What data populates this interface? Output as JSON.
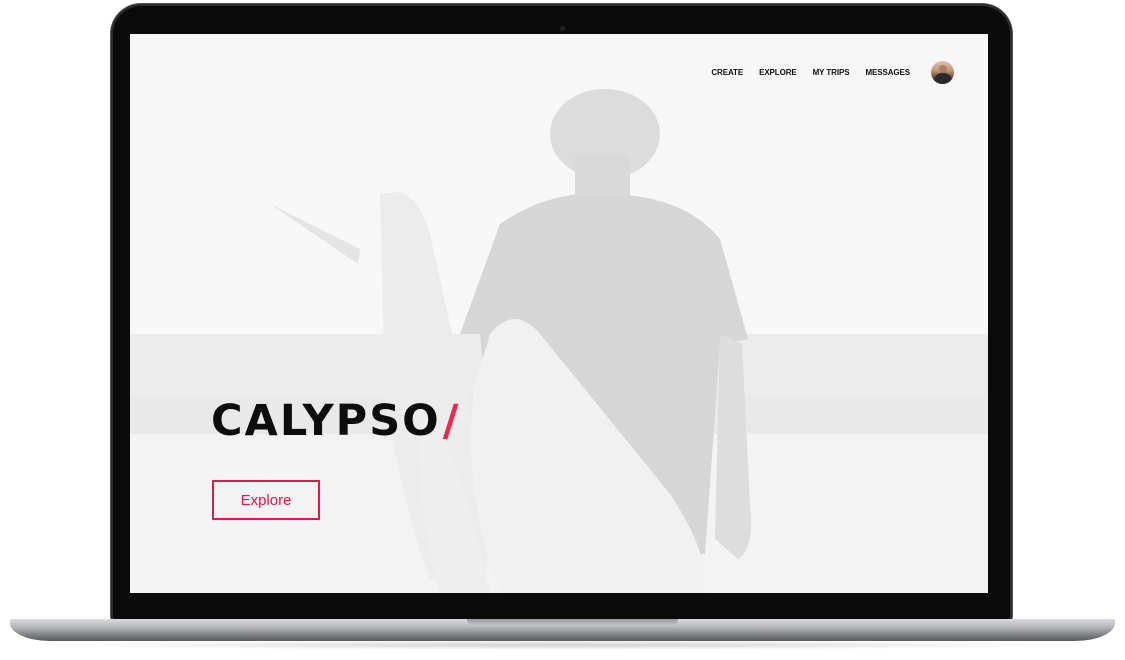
{
  "nav": {
    "links": [
      {
        "label": "CREATE"
      },
      {
        "label": "EXPLORE"
      },
      {
        "label": "MY TRIPS"
      },
      {
        "label": "MESSAGES"
      }
    ]
  },
  "hero": {
    "brand": "CALYPSO",
    "brand_mark": "/",
    "cta_label": "Explore"
  },
  "colors": {
    "accent": "#e8164b",
    "text": "#0d0d0d",
    "background": "#f6f6f6"
  }
}
